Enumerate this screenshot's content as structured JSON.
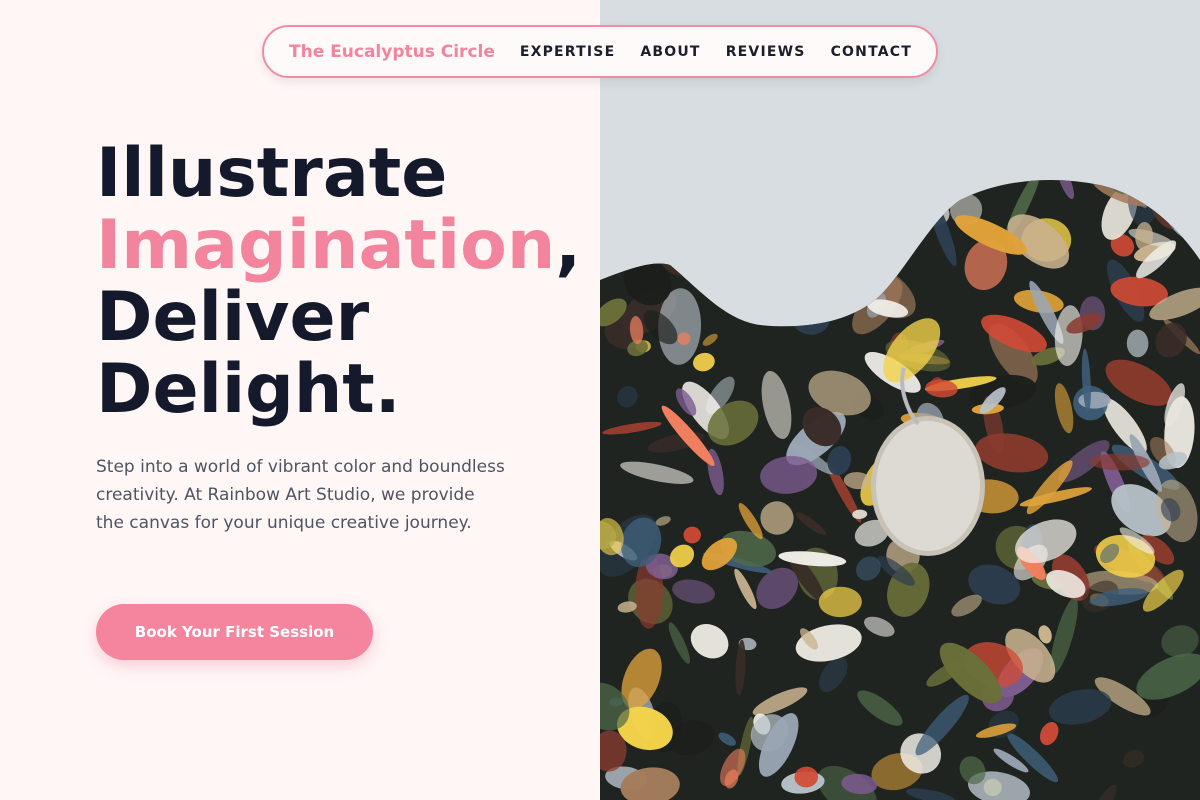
{
  "nav": {
    "brand": "The Eucalyptus Circle",
    "links": [
      "EXPERTISE",
      "ABOUT",
      "REVIEWS",
      "CONTACT"
    ]
  },
  "hero": {
    "headline_line1": "Illustrate",
    "headline_accent": "Imagination",
    "headline_comma": ",",
    "headline_line3": "Deliver",
    "headline_line4": "Delight.",
    "description": "Step into a world of vibrant color and boundless creativity. At Rainbow Art Studio, we provide the canvas for your unique creative journey.",
    "cta_label": "Book Your First Session"
  },
  "colors": {
    "accent": "#f2849e",
    "dark_text": "#141a2b",
    "page_bg": "#fff6f6"
  },
  "image": {
    "subject": "paint-palette-photo"
  }
}
